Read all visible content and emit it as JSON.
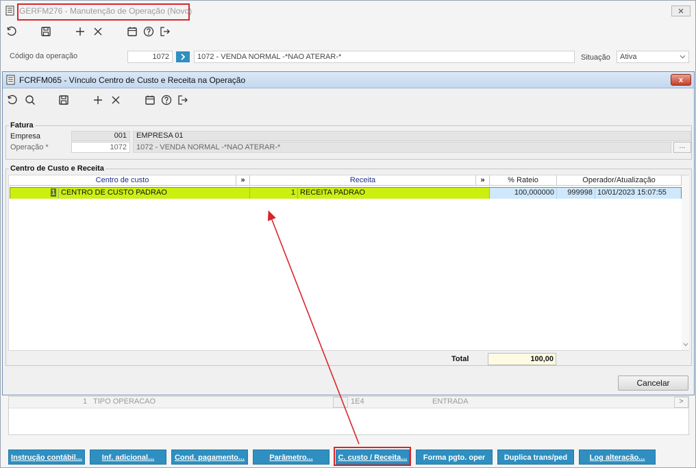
{
  "main": {
    "title": "GERFM276 - Manutenção de Operação (Novo)",
    "codigo_label": "Código da operação",
    "codigo_value": "1072",
    "codigo_desc": "1072 - VENDA NORMAL  -*NAO ATERAR-*",
    "situacao_label": "Situação",
    "situacao_value": "Ativa",
    "bg_row": {
      "num": "1",
      "tipo": "TIPO OPERACAO",
      "code": "1E4",
      "entrada": "ENTRADA",
      "arrow": ">"
    },
    "buttons": [
      "Instrução contábil...",
      "Inf. adicional...",
      "Cond. pagamento...",
      "Parâmetro...",
      "C. custo / Receita...",
      "Forma pgto. oper",
      "Duplica trans/ped",
      "Log alteração..."
    ]
  },
  "dialog": {
    "title": "FCRFM065 - Vínculo Centro de Custo e Receita na Operação",
    "close": "x",
    "fatura": {
      "title": "Fatura",
      "empresa_label": "Empresa",
      "empresa_code": "001",
      "empresa_name": "EMPRESA 01",
      "operacao_label": "Operação *",
      "operacao_code": "1072",
      "operacao_desc": "1072 - VENDA NORMAL  -*NAO ATERAR-*",
      "ellipsis": "..."
    },
    "ccr": {
      "title": "Centro de Custo e Receita",
      "headers": {
        "centro": "Centro de custo",
        "expand1": "»",
        "receita": "Receita",
        "expand2": "»",
        "rateio": "% Rateio",
        "operador": "Operador/Atualização"
      },
      "rows": [
        {
          "cc_code": "1",
          "cc_name": "CENTRO DE CUSTO PADRAO",
          "rec_code": "1",
          "rec_name": "RECEITA PADRAO",
          "rateio": "100,000000",
          "operador": "999998",
          "atualizacao": "10/01/2023 15:07:55"
        }
      ],
      "total_label": "Total",
      "total_value": "100,00"
    },
    "cancel": "Cancelar"
  },
  "colors": {
    "row_highlight": "#ccef0f",
    "rateio_cell": "#cfe8fb",
    "total_bg": "#fffbe3",
    "button_blue": "#2f8fc0",
    "annotation_red": "#d9242a"
  },
  "icons": [
    "document-icon",
    "undo-icon",
    "search-icon",
    "save-icon",
    "add-icon",
    "delete-icon",
    "calendar-icon",
    "help-icon",
    "exit-icon",
    "chevron-right-icon",
    "chevron-down-icon",
    "close-icon"
  ]
}
